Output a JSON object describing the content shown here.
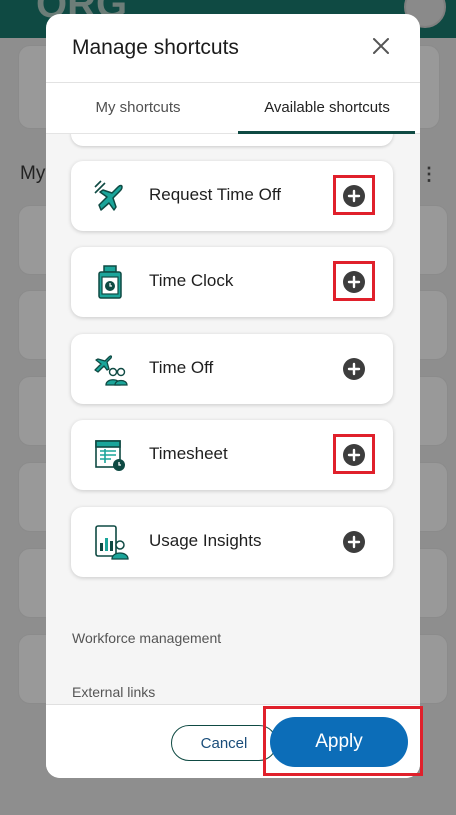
{
  "modal": {
    "title": "Manage shortcuts",
    "close_icon": "close-icon"
  },
  "tabs": [
    {
      "label": "My shortcuts",
      "selected": false
    },
    {
      "label": "Available shortcuts",
      "selected": true
    }
  ],
  "shortcuts": [
    {
      "label": "Request Time Off",
      "icon": "airplane-icon",
      "action_icon": "add-circle-icon",
      "highlighted": true
    },
    {
      "label": "Time Clock",
      "icon": "time-clock-icon",
      "action_icon": "add-circle-icon",
      "highlighted": true
    },
    {
      "label": "Time Off",
      "icon": "time-off-icon",
      "action_icon": "add-circle-icon",
      "highlighted": false
    },
    {
      "label": "Timesheet",
      "icon": "timesheet-icon",
      "action_icon": "add-circle-icon",
      "highlighted": true
    },
    {
      "label": "Usage Insights",
      "icon": "usage-insights-icon",
      "action_icon": "add-circle-icon",
      "highlighted": false
    }
  ],
  "sections": [
    {
      "label": "Workforce management"
    },
    {
      "label": "External links"
    }
  ],
  "footer": {
    "cancel_label": "Cancel",
    "apply_label": "Apply",
    "apply_highlighted": true
  },
  "background": {
    "header_text": "ORG",
    "section_label": "My"
  },
  "colors": {
    "brand_dark": "#0f4a43",
    "accent_teal": "#1ba59a",
    "apply_blue": "#0c6db8",
    "highlight_red": "#e0202b"
  }
}
